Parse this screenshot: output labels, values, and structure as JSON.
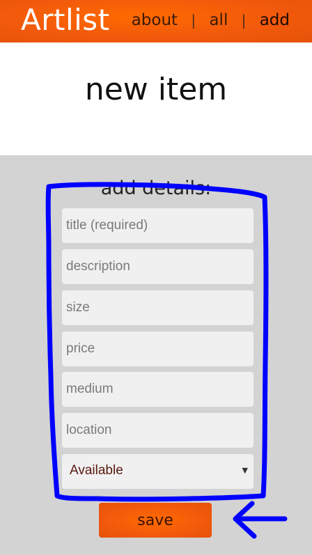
{
  "header": {
    "brand": "Artlist",
    "nav": [
      {
        "label": "about"
      },
      {
        "label": "all"
      },
      {
        "label": "add"
      }
    ],
    "separator": "|"
  },
  "hero": {
    "title": "new item"
  },
  "form": {
    "heading": "add details:",
    "fields": [
      {
        "placeholder": "title (required)",
        "value": ""
      },
      {
        "placeholder": "description",
        "value": ""
      },
      {
        "placeholder": "size",
        "value": ""
      },
      {
        "placeholder": "price",
        "value": ""
      },
      {
        "placeholder": "medium",
        "value": ""
      },
      {
        "placeholder": "location",
        "value": ""
      }
    ],
    "status_select": {
      "selected": "Available",
      "caret": "▼"
    },
    "save_label": "save"
  },
  "colors": {
    "header_orange": "#f25a0c",
    "annotation_blue": "#0000ff"
  }
}
